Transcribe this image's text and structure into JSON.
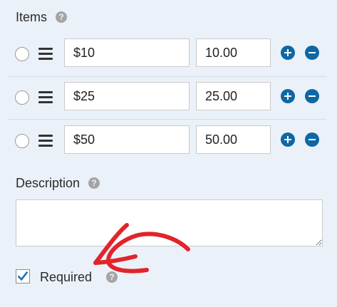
{
  "items_section": {
    "label": "Items",
    "help_glyph": "?"
  },
  "items": [
    {
      "label": "$10",
      "value": "10.00"
    },
    {
      "label": "$25",
      "value": "25.00"
    },
    {
      "label": "$50",
      "value": "50.00"
    }
  ],
  "description": {
    "label": "Description",
    "help_glyph": "?",
    "value": ""
  },
  "required": {
    "label": "Required",
    "checked": true,
    "help_glyph": "?"
  },
  "colors": {
    "background": "#ebf1f9",
    "accent_button": "#0e67a5",
    "annotation_arrow": "#e0252b",
    "help_icon": "#a4a4a4",
    "checkmark": "#1e6fb0"
  },
  "icons": {
    "radio": "radio-circle-icon",
    "drag": "hamburger-drag-icon",
    "add": "plus-circle-icon",
    "remove": "minus-circle-icon",
    "help": "question-circle-icon",
    "check": "checkmark-icon",
    "annotation": "red-arrow-annotation"
  }
}
